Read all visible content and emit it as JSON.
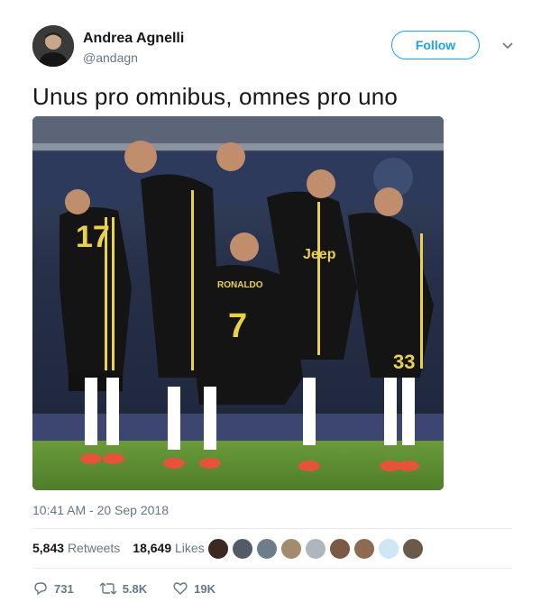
{
  "tweet": {
    "author_name": "Andrea Agnelli",
    "author_handle": "@andagn",
    "follow_label": "Follow",
    "text": "Unus pro omnibus, omnes pro uno",
    "timestamp": "10:41 AM - 20 Sep 2018",
    "retweets_count": "5,843",
    "retweets_label": "Retweets",
    "likes_count": "18,649",
    "likes_label": "Likes"
  },
  "actions": {
    "reply_count": "731",
    "retweet_count": "5.8K",
    "like_count": "19K"
  },
  "photo": {
    "sponsor_text": "Jeep",
    "jersey_name": "RONALDO",
    "jersey_number": "7",
    "other_numbers": [
      "17",
      "33"
    ]
  },
  "colors": {
    "accent": "#1da1f2",
    "secondary_text": "#657786",
    "primary_text": "#14171a"
  },
  "icons": [
    "chevron-down-icon",
    "reply-icon",
    "retweet-icon",
    "like-icon"
  ]
}
